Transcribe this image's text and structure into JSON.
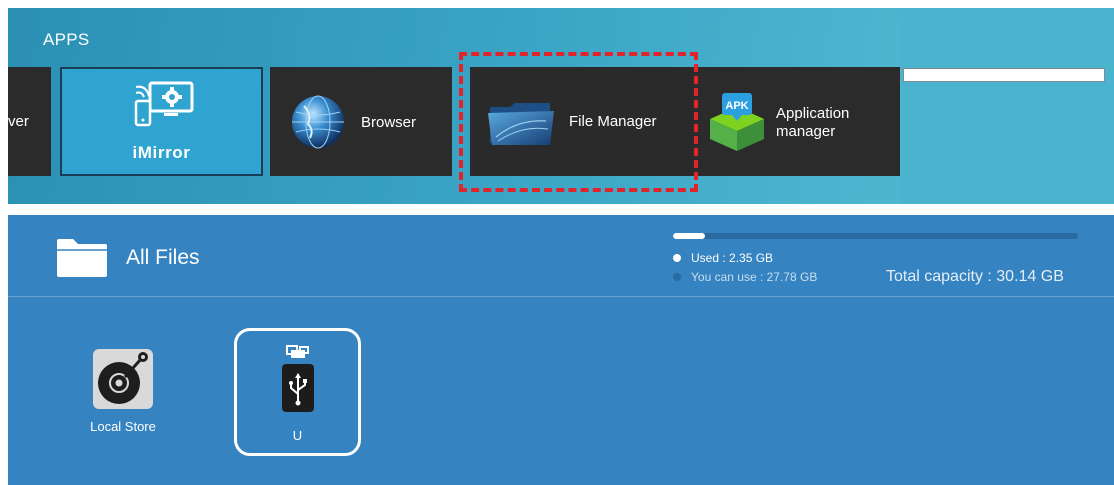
{
  "apps": {
    "title": "APPS",
    "tiles": [
      {
        "label": "ver"
      },
      {
        "label": "iMirror"
      },
      {
        "label": "Browser"
      },
      {
        "label": "File Manager"
      },
      {
        "label_line1": "Application",
        "label_line2": "manager",
        "badge": "APK"
      }
    ],
    "highlight_color": "#e0242a"
  },
  "files": {
    "title": "All Files",
    "storage": {
      "used_text": "Used : 2.35 GB",
      "free_text": "You can use : 27.78 GB",
      "total_text": "Total capacity : 30.14 GB",
      "used_fraction": 0.078
    },
    "items": [
      {
        "label": "Local Store",
        "icon": "disc-icon"
      },
      {
        "label": "U",
        "icon": "usb-drive-icon"
      }
    ]
  },
  "colors": {
    "apps_bg": "#3aa4c6",
    "tile_bg": "#2b2b2b",
    "imirror_bg": "#2fa4d1",
    "files_bg": "#3583c0"
  }
}
